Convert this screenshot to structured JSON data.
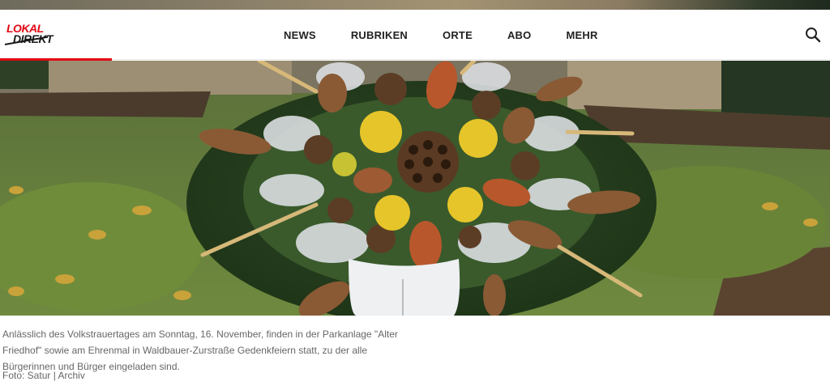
{
  "brand": {
    "line1": "LOKAL",
    "line2": "DIREKT",
    "accent": "#e30613"
  },
  "nav": {
    "items": [
      "NEWS",
      "RUBRIKEN",
      "ORTE",
      "ABO",
      "MEHR"
    ]
  },
  "search": {
    "icon": "search-icon"
  },
  "hero": {
    "subject": "wreath-photo"
  },
  "caption": {
    "text": "Anlässlich des Volkstrauertages am Sonntag, 16. November, finden in der Parkanlage \"Alter Friedhof\" sowie am Ehrenmal in Waldbauer-Zurstraße Gedenkfeiern statt, zu der alle Bürgerinnen und Bürger eingeladen sind.",
    "credit": "Foto: Satur | Archiv"
  }
}
